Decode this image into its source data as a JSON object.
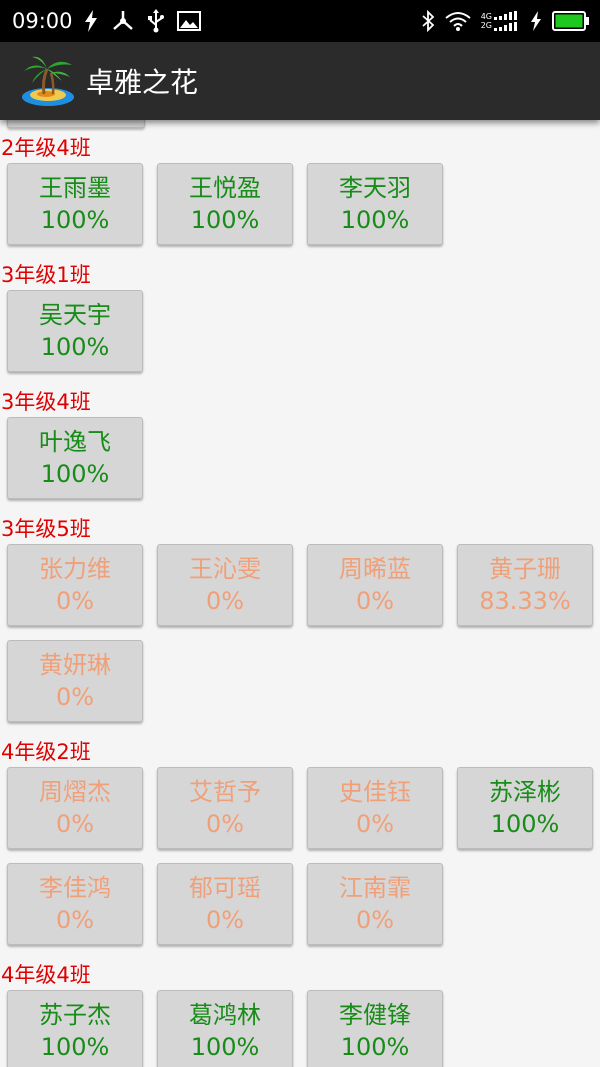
{
  "status_bar": {
    "time": "09:00",
    "left_icons": [
      "flash-icon",
      "usb-share-icon",
      "usb-icon",
      "image-icon"
    ],
    "right_icons": [
      "bluetooth-icon",
      "wifi-icon",
      "signal-icon",
      "charging-icon",
      "battery-icon"
    ],
    "net_labels": [
      "4G",
      "2G"
    ],
    "battery_level": 1.0
  },
  "app_bar": {
    "title": "卓雅之花",
    "logo_icon": "palm-island-icon"
  },
  "colors": {
    "section": "#e00000",
    "complete": "#188c18",
    "incomplete": "#f0a078",
    "button_bg": "#d6d6d6",
    "appbar_bg": "#2b2b2b"
  },
  "sections": [
    {
      "label": "2年级4班",
      "students": [
        {
          "name": "王雨墨",
          "percent": "100%",
          "done": true
        },
        {
          "name": "王悦盈",
          "percent": "100%",
          "done": true
        },
        {
          "name": "李天羽",
          "percent": "100%",
          "done": true
        }
      ]
    },
    {
      "label": "3年级1班",
      "students": [
        {
          "name": "吴天宇",
          "percent": "100%",
          "done": true
        }
      ]
    },
    {
      "label": "3年级4班",
      "students": [
        {
          "name": "叶逸飞",
          "percent": "100%",
          "done": true
        }
      ]
    },
    {
      "label": "3年级5班",
      "students": [
        {
          "name": "张力维",
          "percent": "0%",
          "done": false
        },
        {
          "name": "王沁雯",
          "percent": "0%",
          "done": false
        },
        {
          "name": "周晞蓝",
          "percent": "0%",
          "done": false
        },
        {
          "name": "黄子珊",
          "percent": "83.33%",
          "done": false
        },
        {
          "name": "黄妍琳",
          "percent": "0%",
          "done": false
        }
      ]
    },
    {
      "label": "4年级2班",
      "students": [
        {
          "name": "周熠杰",
          "percent": "0%",
          "done": false
        },
        {
          "name": "艾哲予",
          "percent": "0%",
          "done": false
        },
        {
          "name": "史佳钰",
          "percent": "0%",
          "done": false
        },
        {
          "name": "苏泽彬",
          "percent": "100%",
          "done": true
        },
        {
          "name": "李佳鸿",
          "percent": "0%",
          "done": false
        },
        {
          "name": "郁可瑶",
          "percent": "0%",
          "done": false
        },
        {
          "name": "江南霏",
          "percent": "0%",
          "done": false
        }
      ]
    },
    {
      "label": "4年级4班",
      "students": [
        {
          "name": "苏子杰",
          "percent": "100%",
          "done": true
        },
        {
          "name": "葛鸿林",
          "percent": "100%",
          "done": true
        },
        {
          "name": "李健锋",
          "percent": "100%",
          "done": true
        }
      ]
    }
  ]
}
